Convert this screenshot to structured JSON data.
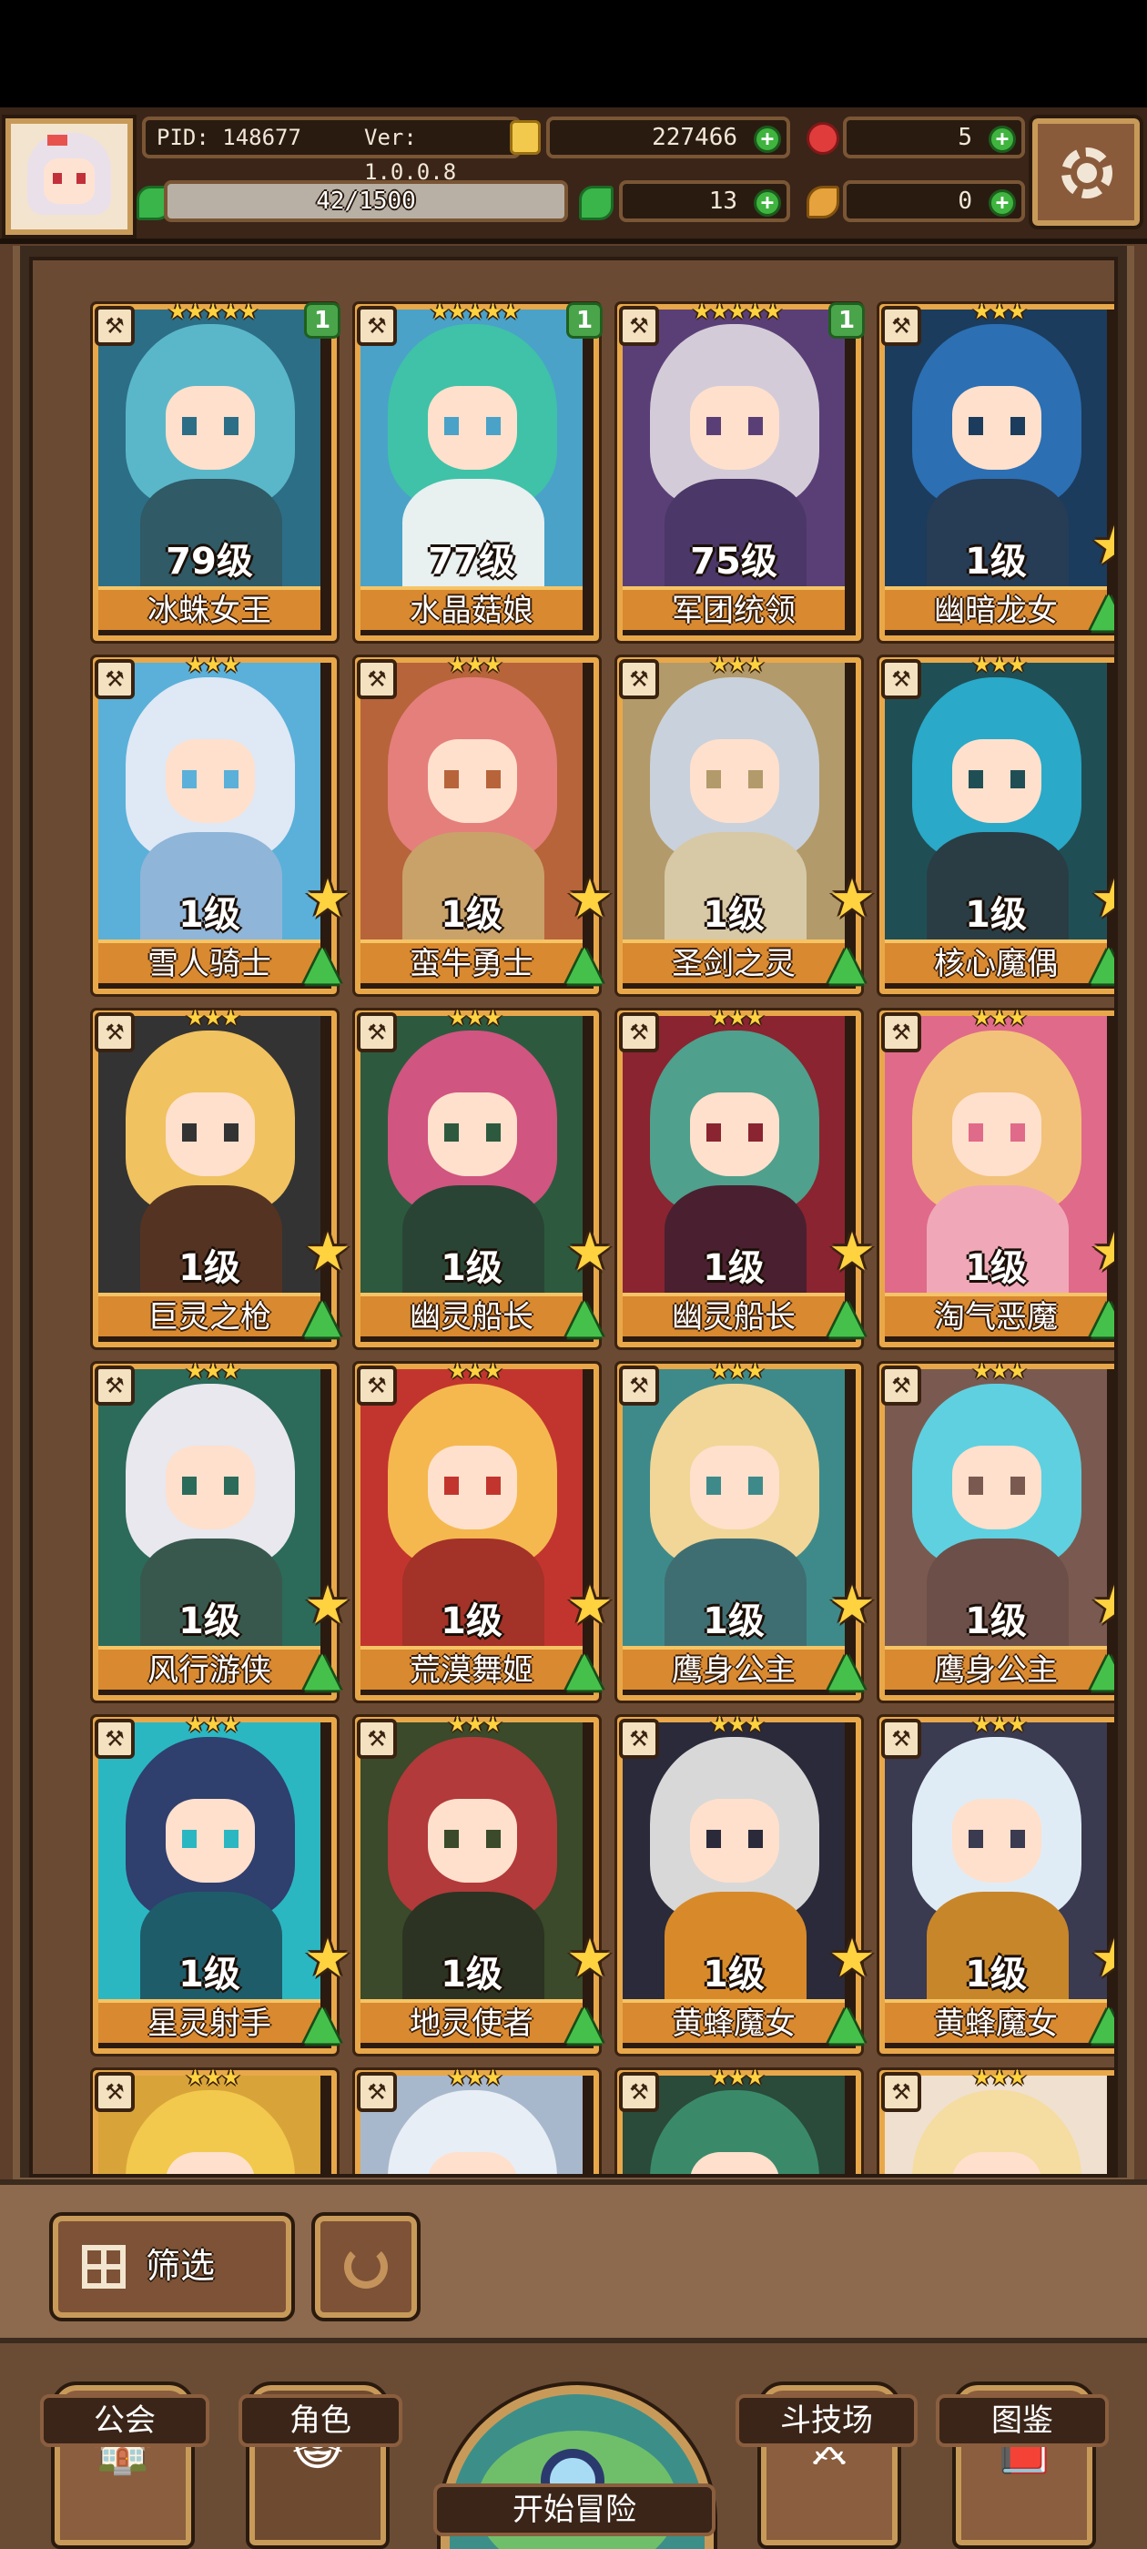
{
  "header": {
    "pid": "PID: 148677",
    "version": "Ver: 1.0.0.8",
    "gold": "227466",
    "gems": "5",
    "stamina": "42/1500",
    "clover": "13",
    "feather": "0"
  },
  "cards": [
    {
      "level": "79级",
      "name": "冰蛛女王",
      "stars": "★★★★★",
      "count": "1",
      "hair": "#5ab7c9",
      "accent": "#2c6e86",
      "body": "#2f5a66"
    },
    {
      "level": "77级",
      "name": "水晶菇娘",
      "stars": "★★★★★",
      "count": "1",
      "hair": "#3fc2a8",
      "accent": "#4aa2c8",
      "body": "#e8f0f0"
    },
    {
      "level": "75级",
      "name": "军团统领",
      "stars": "★★★★★",
      "count": "1",
      "hair": "#d3ccd8",
      "accent": "#5a3f77",
      "body": "#4b3768"
    },
    {
      "level": "1级",
      "name": "幽暗龙女",
      "stars": "★★★",
      "count": "",
      "hair": "#2c6fb3",
      "accent": "#1b3c5c",
      "body": "#273c55"
    },
    {
      "level": "1级",
      "name": "雪人骑士",
      "stars": "★★★",
      "count": "",
      "hair": "#dfe8f5",
      "accent": "#5ab0d9",
      "body": "#8fb5d8"
    },
    {
      "level": "1级",
      "name": "蛮牛勇士",
      "stars": "★★★",
      "count": "",
      "hair": "#e47f7c",
      "accent": "#b7643b",
      "body": "#c9a26a"
    },
    {
      "level": "1级",
      "name": "圣剑之灵",
      "stars": "★★★",
      "count": "",
      "hair": "#c9d1dc",
      "accent": "#b39a6a",
      "body": "#d7c9a6"
    },
    {
      "level": "1级",
      "name": "核心魔偶",
      "stars": "★★★",
      "count": "",
      "hair": "#2aa9c9",
      "accent": "#1f4f55",
      "body": "#2a3d44"
    },
    {
      "level": "1级",
      "name": "巨灵之枪",
      "stars": "★★★",
      "count": "",
      "hair": "#f0c260",
      "accent": "#333333",
      "body": "#553322"
    },
    {
      "level": "1级",
      "name": "幽灵船长",
      "stars": "★★★",
      "count": "",
      "hair": "#d05580",
      "accent": "#2d5a3e",
      "body": "#294435"
    },
    {
      "level": "1级",
      "name": "幽灵船长",
      "stars": "★★★",
      "count": "",
      "hair": "#4fa08c",
      "accent": "#8a2430",
      "body": "#4a2030"
    },
    {
      "level": "1级",
      "name": "淘气恶魔",
      "stars": "★★★",
      "count": "",
      "hair": "#f2c27a",
      "accent": "#e06a8a",
      "body": "#f0a8b8"
    },
    {
      "level": "1级",
      "name": "风行游侠",
      "stars": "★★★",
      "count": "",
      "hair": "#e8e8ee",
      "accent": "#2c6a5a",
      "body": "#38584e"
    },
    {
      "level": "1级",
      "name": "荒漠舞姬",
      "stars": "★★★",
      "count": "",
      "hair": "#f5b84f",
      "accent": "#c2352e",
      "body": "#a33228"
    },
    {
      "level": "1级",
      "name": "鹰身公主",
      "stars": "★★★",
      "count": "",
      "hair": "#f1d698",
      "accent": "#3e8a8a",
      "body": "#3f6e72"
    },
    {
      "level": "1级",
      "name": "鹰身公主",
      "stars": "★★★",
      "count": "",
      "hair": "#5fd0e0",
      "accent": "#7a5a50",
      "body": "#6c4f48"
    },
    {
      "level": "1级",
      "name": "星灵射手",
      "stars": "★★★",
      "count": "",
      "hair": "#2f3f6e",
      "accent": "#2bb7c2",
      "body": "#1f5c6a"
    },
    {
      "level": "1级",
      "name": "地灵使者",
      "stars": "★★★",
      "count": "",
      "hair": "#b23a3a",
      "accent": "#3a4a2a",
      "body": "#2c3322"
    },
    {
      "level": "1级",
      "name": "黄蜂魔女",
      "stars": "★★★",
      "count": "",
      "hair": "#d8d8d8",
      "accent": "#2a2a3a",
      "body": "#d88a2a"
    },
    {
      "level": "1级",
      "name": "黄蜂魔女",
      "stars": "★★★",
      "count": "",
      "hair": "#e0ecf5",
      "accent": "#3a3a50",
      "body": "#c8862a"
    },
    {
      "level": "",
      "name": "",
      "stars": "★★★",
      "count": "",
      "hair": "#f2c94c",
      "accent": "#d8a43a",
      "body": "#d8a43a"
    },
    {
      "level": "",
      "name": "",
      "stars": "★★★",
      "count": "",
      "hair": "#e8eef5",
      "accent": "#a8b8cc",
      "body": "#a8b8cc"
    },
    {
      "level": "",
      "name": "",
      "stars": "★★★",
      "count": "",
      "hair": "#3a8a6a",
      "accent": "#2a4a3a",
      "body": "#2a4a3a"
    },
    {
      "level": "",
      "name": "",
      "stars": "★★★",
      "count": "",
      "hair": "#f5dca0",
      "accent": "#f0e0d0",
      "body": "#f0e0d0"
    }
  ],
  "controls": {
    "filter_label": "筛选"
  },
  "nav": {
    "guild": "公会",
    "character": "角色",
    "adventure": "开始冒险",
    "arena": "斗技场",
    "codex": "图鉴"
  }
}
